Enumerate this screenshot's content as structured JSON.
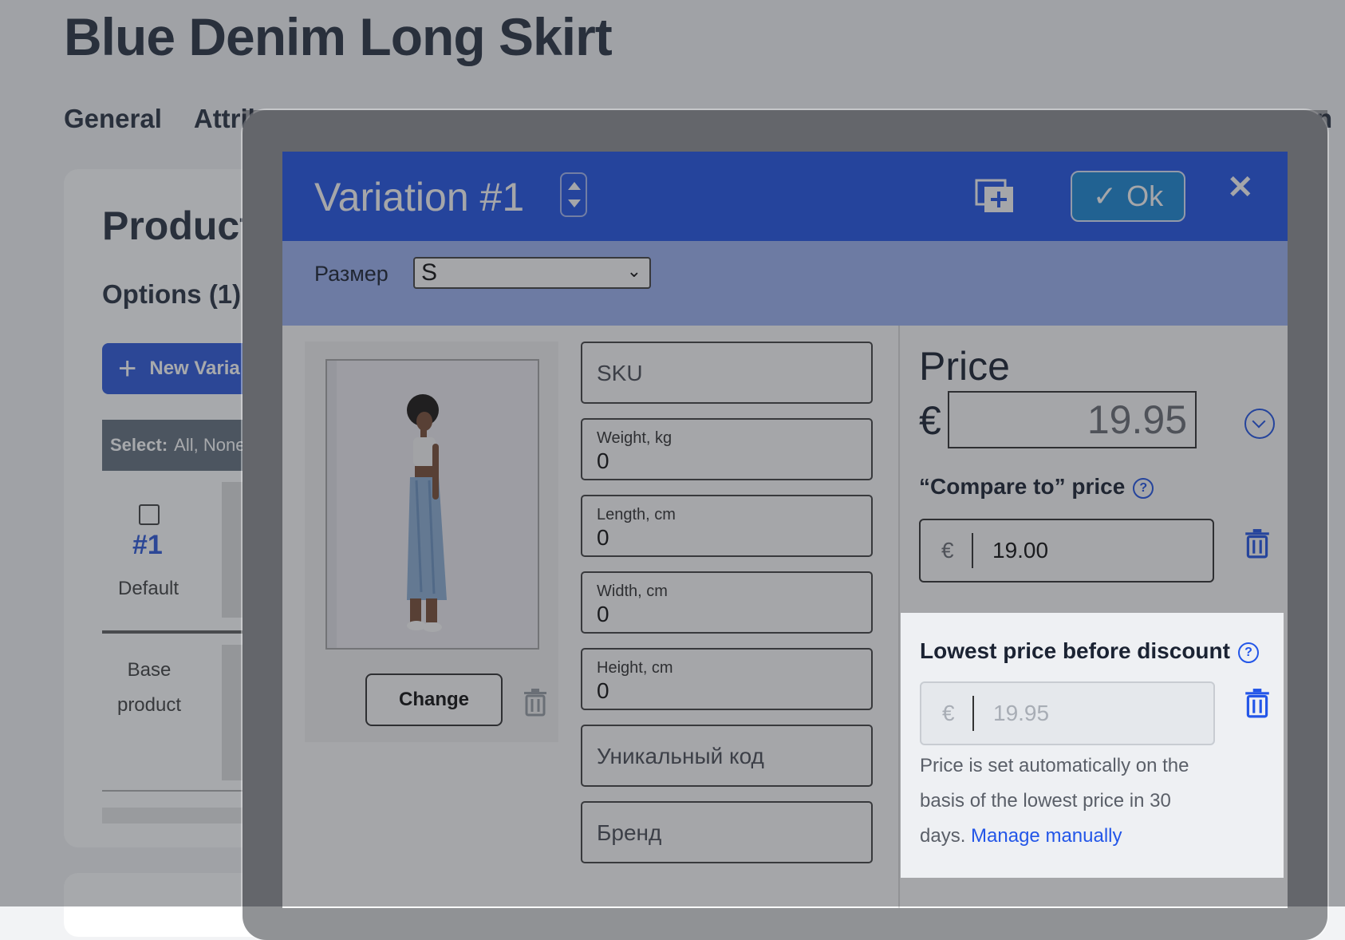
{
  "page": {
    "title": "Blue Denim Long Skirt",
    "tabs": [
      "General",
      "Attrib"
    ],
    "tab_end": "n"
  },
  "sidebar_card": {
    "heading": "Product",
    "options_label": "Options (1)",
    "new_variation_label": "New Varia",
    "select_label": "Select:",
    "select_options": "All, None",
    "variation_number": "#1",
    "variation_default": "Default",
    "base_product_label": "Base product"
  },
  "modal": {
    "title": "Variation #1",
    "ok_label": "Ok",
    "close_label": "✕",
    "size_label": "Размер",
    "size_value": "S",
    "change_button": "Change",
    "fields": {
      "sku_placeholder": "SKU",
      "weight_label": "Weight, kg",
      "weight_value": "0",
      "length_label": "Length, cm",
      "length_value": "0",
      "width_label": "Width, cm",
      "width_value": "0",
      "height_label": "Height, cm",
      "height_value": "0",
      "unique_code_placeholder": "Уникальный код",
      "brand_placeholder": "Бренд"
    },
    "price": {
      "title": "Price",
      "currency": "€",
      "value": "19.95",
      "compare_label": "“Compare to” price",
      "compare_currency": "€",
      "compare_value": "19.00",
      "lowest_label": "Lowest price before discount",
      "lowest_currency": "€",
      "lowest_value": "19.95",
      "lowest_help": "Price is set automatically on the basis of the lowest price in 30 days.",
      "manage_manually": "Manage manually"
    }
  },
  "colors": {
    "accent": "#2356e8",
    "ok_button": "#1d8ad8"
  }
}
